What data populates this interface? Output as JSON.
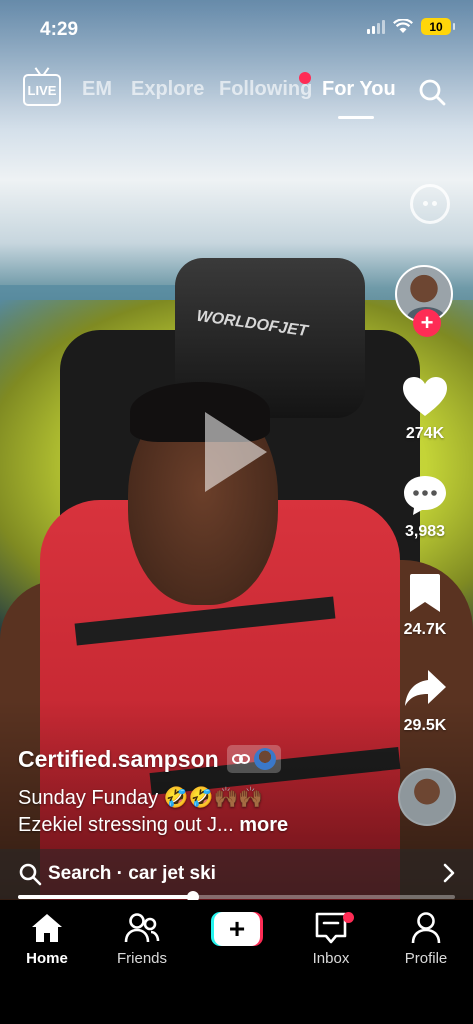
{
  "status_bar": {
    "time": "4:29",
    "battery": "10"
  },
  "top_nav": {
    "live_label": "LIVE",
    "tabs": [
      {
        "label": "EM",
        "active": false
      },
      {
        "label": "Explore",
        "active": false
      },
      {
        "label": "Following",
        "active": false,
        "has_notification": true
      },
      {
        "label": "For You",
        "active": true
      }
    ]
  },
  "post": {
    "username": "Certified.sampson",
    "caption_line1": "Sunday Funday 🤣🤣🙌🏾🙌🏾",
    "caption_line2": "Ezekiel stressing out J...",
    "more_label": "more",
    "headrest_text": "WORLDOFJET"
  },
  "actions": {
    "likes": "274K",
    "comments": "3,983",
    "saves": "24.7K",
    "shares": "29.5K",
    "follow_symbol": "+"
  },
  "search_bar": {
    "text": "Search · car jet ski"
  },
  "progress": {
    "fraction": 0.4
  },
  "bottom_nav": {
    "items": [
      {
        "label": "Home",
        "active": true
      },
      {
        "label": "Friends",
        "active": false
      },
      {
        "label": "+",
        "active": false
      },
      {
        "label": "Inbox",
        "active": false,
        "has_notification": true
      },
      {
        "label": "Profile",
        "active": false
      }
    ]
  },
  "colors": {
    "accent": "#fe2c55",
    "cyan": "#25f4ee",
    "battery": "#ffd60a"
  }
}
